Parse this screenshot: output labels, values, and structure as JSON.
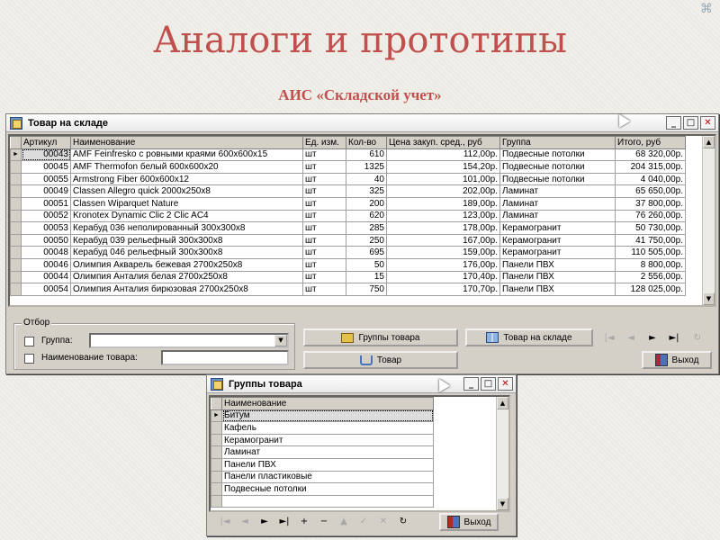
{
  "slide": {
    "title": "Аналоги и прототипы",
    "subtitle": "АИС «Складской учет»",
    "corner_mark": "⌘"
  },
  "warehouse_window": {
    "title": "Товар на складе",
    "columns": [
      "Артикул",
      "Наименование",
      "Ед. изм.",
      "Кол-во",
      "Цена закуп. сред., руб",
      "Группа",
      "Итого, руб"
    ],
    "rows": [
      [
        "00043",
        "AMF Feinfresko с ровными краями 600x600x15",
        "шт",
        "610",
        "112,00р.",
        "Подвесные потолки",
        "68 320,00р."
      ],
      [
        "00045",
        "AMF Thermofon белый 600x600x20",
        "шт",
        "1325",
        "154,20р.",
        "Подвесные потолки",
        "204 315,00р."
      ],
      [
        "00055",
        "Armstrong Fiber 600x600x12",
        "шт",
        "40",
        "101,00р.",
        "Подвесные потолки",
        "4 040,00р."
      ],
      [
        "00049",
        "Classen Allegro quick 2000x250x8",
        "шт",
        "325",
        "202,00р.",
        "Ламинат",
        "65 650,00р."
      ],
      [
        "00051",
        "Classen Wiparquet Nature",
        "шт",
        "200",
        "189,00р.",
        "Ламинат",
        "37 800,00р."
      ],
      [
        "00052",
        "Kronotex Dynamic Clic 2 Clic AC4",
        "шт",
        "620",
        "123,00р.",
        "Ламинат",
        "76 260,00р."
      ],
      [
        "00053",
        "Керабуд 036 неполированный 300x300x8",
        "шт",
        "285",
        "178,00р.",
        "Керамогранит",
        "50 730,00р."
      ],
      [
        "00050",
        "Керабуд 039 рельефный 300x300x8",
        "шт",
        "250",
        "167,00р.",
        "Керамогранит",
        "41 750,00р."
      ],
      [
        "00048",
        "Керабуд 046 рельефный 300x300x8",
        "шт",
        "695",
        "159,00р.",
        "Керамогранит",
        "110 505,00р."
      ],
      [
        "00046",
        "Олимпия Акварель бежевая 2700x250x8",
        "шт",
        "50",
        "176,00р.",
        "Панели ПВХ",
        "8 800,00р."
      ],
      [
        "00044",
        "Олимпия Анталия белая 2700x250x8",
        "шт",
        "15",
        "170,40р.",
        "Панели ПВХ",
        "2 556,00р."
      ],
      [
        "00054",
        "Олимпия Анталия бирюзовая 2700x250x8",
        "шт",
        "750",
        "170,70р.",
        "Панели ПВХ",
        "128 025,00р."
      ]
    ],
    "filter": {
      "title": "Отбор",
      "group_label": "Группа:",
      "name_label": "Наименование товара:"
    },
    "buttons": {
      "groups": "Группы товара",
      "stock": "Товар на складе",
      "product": "Товар",
      "exit": "Выход"
    },
    "nav": [
      "|◄",
      "◄",
      "►",
      "►|",
      "↻"
    ]
  },
  "groups_window": {
    "title": "Группы товара",
    "column": "Наименование",
    "rows": [
      "Битум",
      "Кафель",
      "Керамогранит",
      "Ламинат",
      "Панели ПВХ",
      "Панели пластиковые",
      "Подвесные потолки"
    ],
    "nav": [
      "|◄",
      "◄",
      "►",
      "►|",
      "+",
      "−",
      "▲",
      "✓",
      "✕",
      "↻"
    ],
    "exit": "Выход"
  },
  "titlebar_buttons": {
    "minimize": "_",
    "maximize": "□",
    "close": "✕"
  },
  "row_indicator": "►"
}
